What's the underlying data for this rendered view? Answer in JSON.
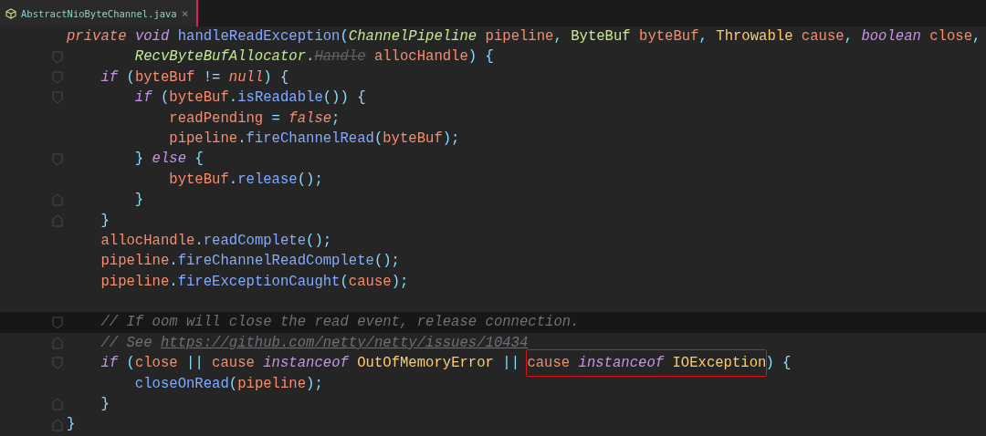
{
  "tab": {
    "filename": "AbstractNioByteChannel.java",
    "close": "×",
    "selected": true
  },
  "lines": [
    {
      "current": false,
      "fold_start": false,
      "fold_end": false,
      "tokens": [
        {
          "kind": "modifier",
          "text": "private "
        },
        {
          "kind": "keyword",
          "text": "void "
        },
        {
          "kind": "method",
          "text": "handleReadException"
        },
        {
          "kind": "punct",
          "text": "("
        },
        {
          "kind": "type",
          "text": "ChannelPipeline "
        },
        {
          "kind": "variable",
          "text": "pipeline"
        },
        {
          "kind": "punct",
          "text": ", "
        },
        {
          "kind": "type-plain",
          "text": "ByteBuf "
        },
        {
          "kind": "variable",
          "text": "byteBuf"
        },
        {
          "kind": "punct",
          "text": ", "
        },
        {
          "kind": "class",
          "text": "Throwable "
        },
        {
          "kind": "variable",
          "text": "cause"
        },
        {
          "kind": "punct",
          "text": ", "
        },
        {
          "kind": "keyword",
          "text": "boolean "
        },
        {
          "kind": "variable",
          "text": "close"
        },
        {
          "kind": "punct",
          "text": ","
        }
      ]
    },
    {
      "current": false,
      "fold_start": true,
      "fold_end": false,
      "tokens": [
        {
          "kind": "type",
          "text": "        RecvByteBufAllocator"
        },
        {
          "kind": "punct",
          "text": "."
        },
        {
          "kind": "deprecated",
          "text": "Handle"
        },
        {
          "kind": "variable",
          "text": " allocHandle"
        },
        {
          "kind": "punct",
          "text": ") {"
        }
      ]
    },
    {
      "current": false,
      "fold_start": true,
      "fold_end": false,
      "tokens": [
        {
          "kind": "keyword",
          "text": "    if "
        },
        {
          "kind": "punct",
          "text": "("
        },
        {
          "kind": "variable",
          "text": "byteBuf "
        },
        {
          "kind": "punct",
          "text": "!= "
        },
        {
          "kind": "modifier",
          "text": "null"
        },
        {
          "kind": "punct",
          "text": ") {"
        }
      ]
    },
    {
      "current": false,
      "fold_start": true,
      "fold_end": false,
      "tokens": [
        {
          "kind": "keyword",
          "text": "        if "
        },
        {
          "kind": "punct",
          "text": "("
        },
        {
          "kind": "variable",
          "text": "byteBuf"
        },
        {
          "kind": "punct",
          "text": "."
        },
        {
          "kind": "method",
          "text": "isReadable"
        },
        {
          "kind": "punct",
          "text": "()) {"
        }
      ]
    },
    {
      "current": false,
      "fold_start": false,
      "fold_end": false,
      "tokens": [
        {
          "kind": "variable",
          "text": "            readPending "
        },
        {
          "kind": "punct",
          "text": "= "
        },
        {
          "kind": "modifier",
          "text": "false"
        },
        {
          "kind": "punct",
          "text": ";"
        }
      ]
    },
    {
      "current": false,
      "fold_start": false,
      "fold_end": false,
      "tokens": [
        {
          "kind": "variable",
          "text": "            pipeline"
        },
        {
          "kind": "punct",
          "text": "."
        },
        {
          "kind": "method",
          "text": "fireChannelRead"
        },
        {
          "kind": "punct",
          "text": "("
        },
        {
          "kind": "variable",
          "text": "byteBuf"
        },
        {
          "kind": "punct",
          "text": ");"
        }
      ]
    },
    {
      "current": false,
      "fold_start": true,
      "fold_end": false,
      "tokens": [
        {
          "kind": "punct",
          "text": "        } "
        },
        {
          "kind": "keyword",
          "text": "else "
        },
        {
          "kind": "punct",
          "text": "{"
        }
      ]
    },
    {
      "current": false,
      "fold_start": false,
      "fold_end": false,
      "tokens": [
        {
          "kind": "variable",
          "text": "            byteBuf"
        },
        {
          "kind": "punct",
          "text": "."
        },
        {
          "kind": "method",
          "text": "release"
        },
        {
          "kind": "punct",
          "text": "();"
        }
      ]
    },
    {
      "current": false,
      "fold_start": false,
      "fold_end": true,
      "tokens": [
        {
          "kind": "punct",
          "text": "        }"
        }
      ]
    },
    {
      "current": false,
      "fold_start": false,
      "fold_end": true,
      "tokens": [
        {
          "kind": "punct",
          "text": "    }"
        }
      ]
    },
    {
      "current": false,
      "fold_start": false,
      "fold_end": false,
      "tokens": [
        {
          "kind": "variable",
          "text": "    allocHandle"
        },
        {
          "kind": "punct",
          "text": "."
        },
        {
          "kind": "method",
          "text": "readComplete"
        },
        {
          "kind": "punct",
          "text": "();"
        }
      ]
    },
    {
      "current": false,
      "fold_start": false,
      "fold_end": false,
      "tokens": [
        {
          "kind": "variable",
          "text": "    pipeline"
        },
        {
          "kind": "punct",
          "text": "."
        },
        {
          "kind": "method",
          "text": "fireChannelReadComplete"
        },
        {
          "kind": "punct",
          "text": "();"
        }
      ]
    },
    {
      "current": false,
      "fold_start": false,
      "fold_end": false,
      "tokens": [
        {
          "kind": "variable",
          "text": "    pipeline"
        },
        {
          "kind": "punct",
          "text": "."
        },
        {
          "kind": "method",
          "text": "fireExceptionCaught"
        },
        {
          "kind": "punct",
          "text": "("
        },
        {
          "kind": "variable",
          "text": "cause"
        },
        {
          "kind": "punct",
          "text": ");"
        }
      ]
    },
    {
      "current": false,
      "fold_start": false,
      "fold_end": false
    },
    {
      "current": true,
      "fold_start": true,
      "fold_end": false,
      "tokens": [
        {
          "kind": "comment",
          "text": "    // If oom will close the read event, release connection."
        }
      ]
    },
    {
      "current": false,
      "fold_start": false,
      "fold_end": true,
      "tokens": [
        {
          "kind": "comment",
          "text": "    // See "
        },
        {
          "kind": "link",
          "text": "https://github.com/netty/netty/issues/10434"
        }
      ]
    },
    {
      "current": false,
      "fold_start": true,
      "fold_end": false,
      "tokens": [
        {
          "kind": "keyword",
          "text": "    if "
        },
        {
          "kind": "punct",
          "text": "("
        },
        {
          "kind": "variable",
          "text": "close "
        },
        {
          "kind": "punct",
          "text": "|| "
        },
        {
          "kind": "variable",
          "text": "cause "
        },
        {
          "kind": "keyword",
          "text": "instanceof "
        },
        {
          "kind": "class",
          "text": "OutOfMemoryError "
        },
        {
          "kind": "punct",
          "text": "|| "
        },
        {
          "kind": "variable",
          "text": "cause ",
          "boxed": true
        },
        {
          "kind": "keyword",
          "text": "instanceof ",
          "boxed": true
        },
        {
          "kind": "class",
          "text": "IOException",
          "boxed": true
        },
        {
          "kind": "punct",
          "text": ") {"
        }
      ]
    },
    {
      "current": false,
      "fold_start": false,
      "fold_end": false,
      "tokens": [
        {
          "kind": "method",
          "text": "        closeOnRead"
        },
        {
          "kind": "punct",
          "text": "("
        },
        {
          "kind": "variable",
          "text": "pipeline"
        },
        {
          "kind": "punct",
          "text": ");"
        }
      ]
    },
    {
      "current": false,
      "fold_start": false,
      "fold_end": true,
      "tokens": [
        {
          "kind": "punct",
          "text": "    }"
        }
      ]
    },
    {
      "current": false,
      "fold_start": false,
      "fold_end": true,
      "tokens": [
        {
          "kind": "punct",
          "text": "}"
        }
      ]
    }
  ]
}
